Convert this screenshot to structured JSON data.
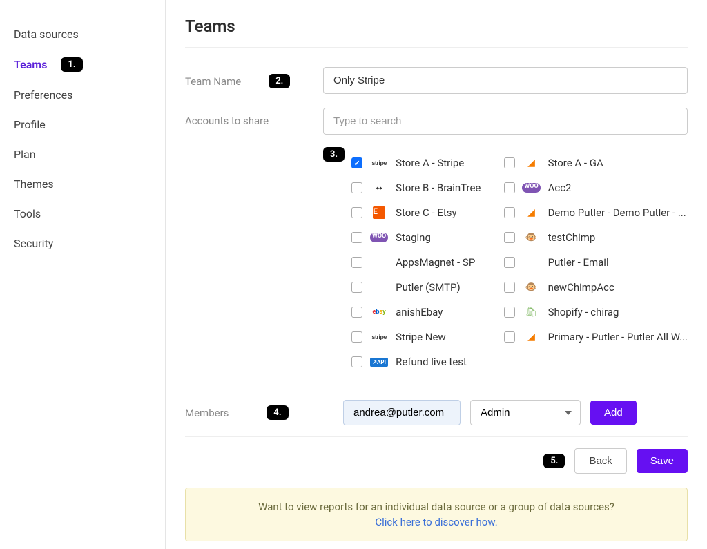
{
  "sidebar": {
    "items": [
      {
        "label": "Data sources",
        "active": false
      },
      {
        "label": "Teams",
        "active": true,
        "step": "1."
      },
      {
        "label": "Preferences",
        "active": false
      },
      {
        "label": "Profile",
        "active": false
      },
      {
        "label": "Plan",
        "active": false
      },
      {
        "label": "Themes",
        "active": false
      },
      {
        "label": "Tools",
        "active": false
      },
      {
        "label": "Security",
        "active": false
      }
    ]
  },
  "page": {
    "title": "Teams"
  },
  "form": {
    "team_name_label": "Team Name",
    "team_name_value": "Only Stripe",
    "team_name_step": "2.",
    "accounts_label": "Accounts to share",
    "accounts_search_placeholder": "Type to search",
    "accounts_step": "3.",
    "accounts_left": [
      {
        "label": "Store A - Stripe",
        "icon": "stripe",
        "checked": true
      },
      {
        "label": "Store B - BrainTree",
        "icon": "braintree",
        "checked": false
      },
      {
        "label": "Store C - Etsy",
        "icon": "etsy",
        "checked": false
      },
      {
        "label": "Staging",
        "icon": "woo",
        "checked": false
      },
      {
        "label": "AppsMagnet - SP",
        "icon": "",
        "checked": false
      },
      {
        "label": "Putler (SMTP)",
        "icon": "",
        "checked": false
      },
      {
        "label": "anishEbay",
        "icon": "ebay",
        "checked": false
      },
      {
        "label": "Stripe New",
        "icon": "stripe",
        "checked": false
      },
      {
        "label": "Refund live test",
        "icon": "api",
        "checked": false
      }
    ],
    "accounts_right": [
      {
        "label": "Store A - GA",
        "icon": "ga",
        "checked": false
      },
      {
        "label": "Acc2",
        "icon": "woo",
        "checked": false
      },
      {
        "label": "Demo Putler - Demo Putler - ...",
        "icon": "ga",
        "checked": false
      },
      {
        "label": "testChimp",
        "icon": "mc",
        "checked": false
      },
      {
        "label": "Putler - Email",
        "icon": "",
        "checked": false
      },
      {
        "label": "newChimpAcc",
        "icon": "mc",
        "checked": false
      },
      {
        "label": "Shopify - chirag",
        "icon": "shopify",
        "checked": false
      },
      {
        "label": "Primary - Putler - Putler All W...",
        "icon": "ga",
        "checked": false
      }
    ],
    "members_label": "Members",
    "members_step": "4.",
    "member_email": "andrea@putler.com",
    "member_role": "Admin",
    "add_label": "Add",
    "back_label": "Back",
    "save_label": "Save",
    "save_step": "5."
  },
  "banner": {
    "line1": "Want to view reports for an individual data source or a group of data sources?",
    "link": "Click here to discover how."
  }
}
